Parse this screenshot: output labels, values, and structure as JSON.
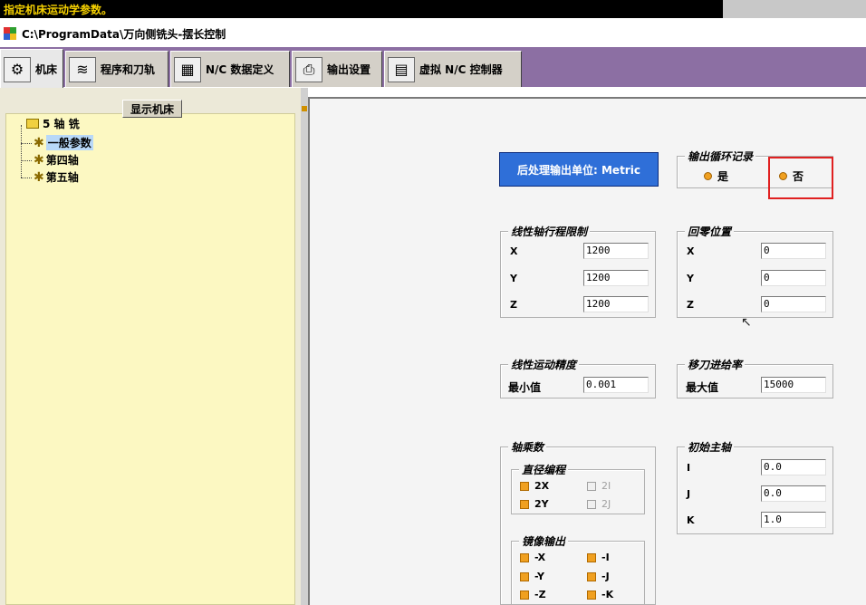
{
  "status_bar": {
    "text": "指定机床运动学参数。"
  },
  "path_bar": {
    "path": "C:\\ProgramData\\万向侧铣头-摆长控制"
  },
  "tabs": [
    {
      "label": "机床",
      "icon": "machine-icon"
    },
    {
      "label": "程序和刀轨",
      "icon": "toolpath-icon"
    },
    {
      "label": "N/C 数据定义",
      "icon": "nc-data-icon"
    },
    {
      "label": "输出设置",
      "icon": "printer-icon"
    },
    {
      "label": "虚拟 N/C 控制器",
      "icon": "controller-icon"
    }
  ],
  "left": {
    "show_machine_button": "显示机床",
    "tree": {
      "root": "5 轴 铣",
      "children": [
        "一般参数",
        "第四轴",
        "第五轴"
      ],
      "selected": "一般参数"
    }
  },
  "main": {
    "output_unit": "后处理输出单位:  Metric",
    "cycle_output": {
      "title": "输出循环记录",
      "options": [
        "是",
        "否"
      ],
      "selected": "否"
    },
    "linear_limits": {
      "title": "线性轴行程限制",
      "rows": [
        {
          "axis": "X",
          "value": "1200"
        },
        {
          "axis": "Y",
          "value": "1200"
        },
        {
          "axis": "Z",
          "value": "1200"
        }
      ]
    },
    "home_position": {
      "title": "回零位置",
      "rows": [
        {
          "axis": "X",
          "value": "0"
        },
        {
          "axis": "Y",
          "value": "0"
        },
        {
          "axis": "Z",
          "value": "0"
        }
      ]
    },
    "linear_resolution": {
      "title": "线性运动精度",
      "label": "最小值",
      "value": "0.001"
    },
    "traverse_feed": {
      "title": "移刀进给率",
      "label": "最大值",
      "value": "15000"
    },
    "multiplier": {
      "title": "轴乘数",
      "diameter": {
        "title": "直径编程",
        "items": [
          {
            "label": "2X",
            "checked": true
          },
          {
            "label": "2I",
            "checked": false
          },
          {
            "label": "2Y",
            "checked": true
          },
          {
            "label": "2J",
            "checked": false
          }
        ]
      },
      "mirror": {
        "title": "镜像输出",
        "items": [
          {
            "label": "-X"
          },
          {
            "label": "-I"
          },
          {
            "label": "-Y"
          },
          {
            "label": "-J"
          },
          {
            "label": "-Z"
          },
          {
            "label": "-K"
          }
        ]
      }
    },
    "initial_spindle": {
      "title": "初始主轴",
      "rows": [
        {
          "axis": "I",
          "value": "0.0"
        },
        {
          "axis": "J",
          "value": "0.0"
        },
        {
          "axis": "K",
          "value": "1.0"
        }
      ]
    }
  },
  "colors": {
    "tab_bar_bg": "#8c6fa3",
    "status_text": "#f5d000",
    "unit_box_bg": "#2f6fd8",
    "highlight": "#e02020",
    "tree_bg": "#fcf8c2"
  }
}
